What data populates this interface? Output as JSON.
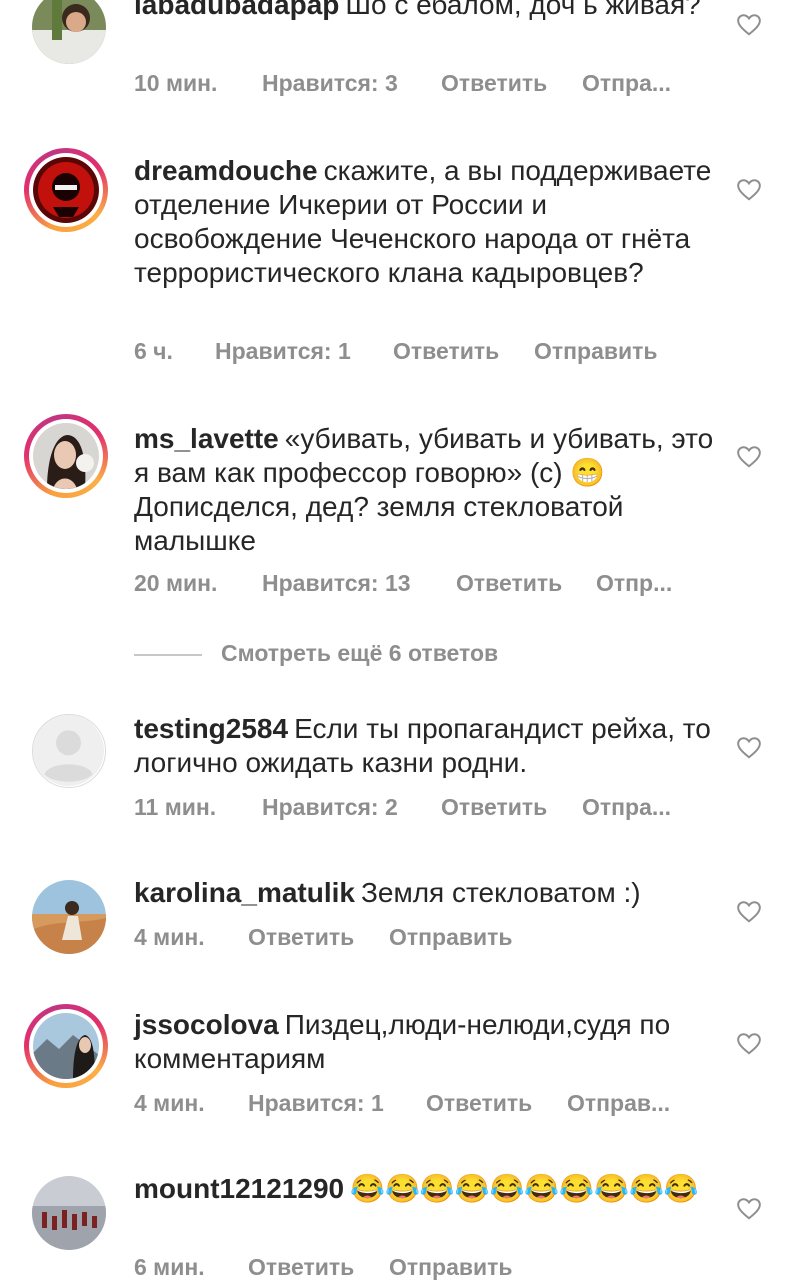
{
  "comments": [
    {
      "username": "labadubadapap",
      "text": "Шо с ебалом, доч ь живая?",
      "time": "10 мин.",
      "likes": "Нравится: 3",
      "reply": "Ответить",
      "send": "Отпра..."
    },
    {
      "username": "dreamdouche",
      "text": "скажите, а вы поддерживаете отделение Ичкерии от России и освобождение Чеченского народа от гнёта террористического клана кадыровцев?",
      "time": "6 ч.",
      "likes": "Нравится: 1",
      "reply": "Ответить",
      "send": "Отправить"
    },
    {
      "username": "ms_lavette",
      "text": "«убивать, убивать и убивать, это я вам как профессор говорю» (с) 😁 Дописделся, дед? земля стекловатой малышке",
      "time": "20 мин.",
      "likes": "Нравится: 13",
      "reply": "Ответить",
      "send": "Отпр..."
    },
    {
      "username": "testing2584",
      "text": "Если ты пропагандист рейха, то логично ожидать казни родни.",
      "time": "11 мин.",
      "likes": "Нравится: 2",
      "reply": "Ответить",
      "send": "Отпра..."
    },
    {
      "username": "karolina_matulik",
      "text": "Земля стекловатом :)",
      "time": "4 мин.",
      "reply": "Ответить",
      "send": "Отправить"
    },
    {
      "username": "jssocolova",
      "text": "Пиздец,люди-нелюди,судя по комментариям",
      "time": "4 мин.",
      "likes": "Нравится: 1",
      "reply": "Ответить",
      "send": "Отправ..."
    },
    {
      "username": "mount12121290",
      "text": "😂😂😂😂😂😂😂😂😂😂",
      "time": "6 мин.",
      "reply": "Ответить",
      "send": "Отправить"
    }
  ],
  "view_more": "Смотреть ещё 6 ответов",
  "icons": {
    "like": "heart-outline-icon",
    "avatar_placeholder": "default-avatar-icon"
  },
  "colors": {
    "text": "#262626",
    "meta": "#8e8e8e",
    "story_ring_start": "#f9a03f",
    "story_ring_end": "#c13584"
  }
}
